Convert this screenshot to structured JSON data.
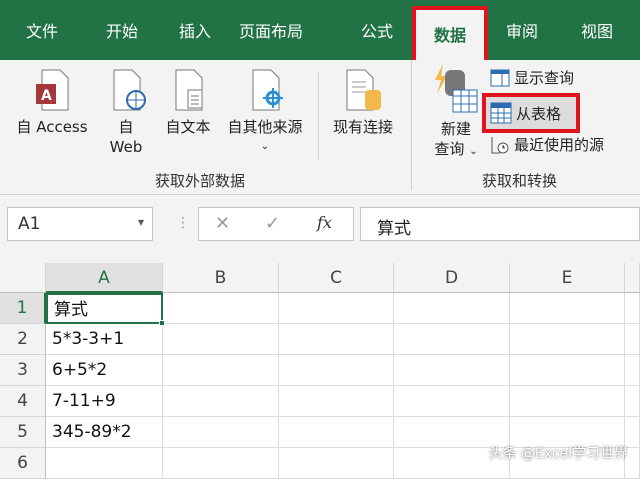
{
  "tabs": [
    "文件",
    "开始",
    "插入",
    "页面布局",
    "公式",
    "数据",
    "审阅",
    "视图"
  ],
  "ribbon": {
    "access": "自 Access",
    "web_1": "自",
    "web_2": "Web",
    "text": "自文本",
    "other": "自其他来源",
    "existing": "现有连接",
    "group1": "获取外部数据",
    "new_query_1": "新建",
    "new_query_2": "查询",
    "show_queries": "显示查询",
    "from_table": "从表格",
    "recent_sources": "最近使用的源",
    "group2": "获取和转换"
  },
  "formula_bar": {
    "name_box": "A1",
    "fx": "fx",
    "cancel": "✕",
    "enter": "✓",
    "content": "算式"
  },
  "columns": [
    "A",
    "B",
    "C",
    "D",
    "E"
  ],
  "rows": [
    "1",
    "2",
    "3",
    "4",
    "5",
    "6"
  ],
  "cells": [
    "算式",
    "5*3-3+1",
    "6+5*2",
    "7-11+9",
    "345-89*2",
    ""
  ],
  "watermark": "头条 @Excel学习世界",
  "colors": {
    "green": "#217346",
    "highlight": "#e0141e"
  }
}
